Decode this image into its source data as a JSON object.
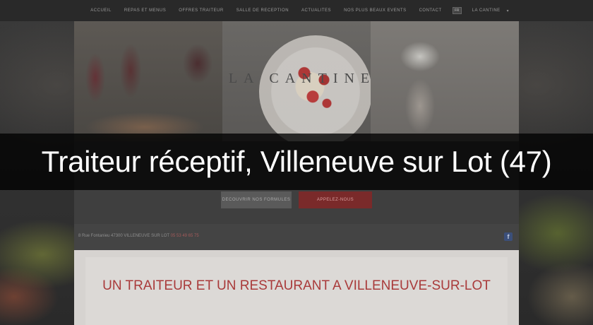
{
  "nav": {
    "items": [
      "Accueil",
      "Repas et menus",
      "Offres traiteur",
      "Salle de reception",
      "Actualites",
      "Nos plus beaux events",
      "Contact"
    ],
    "language_flag": "FR",
    "language_label": "La cantine"
  },
  "hero": {
    "brand": "LA CANTINE",
    "button_primary": "Decouvrir nos formules",
    "button_secondary": "Appelez-nous"
  },
  "address": {
    "text": "8 Rue Fontanieu 47300 VILLENEUVE SUR LOT",
    "phone": "05 53 49 65 75",
    "facebook_glyph": "f"
  },
  "content": {
    "heading": "UN TRAITEUR ET UN RESTAURANT A VILLENEUVE-SUR-LOT"
  },
  "caption": {
    "text": "Traiteur réceptif, Villeneuve sur Lot (47)"
  }
}
